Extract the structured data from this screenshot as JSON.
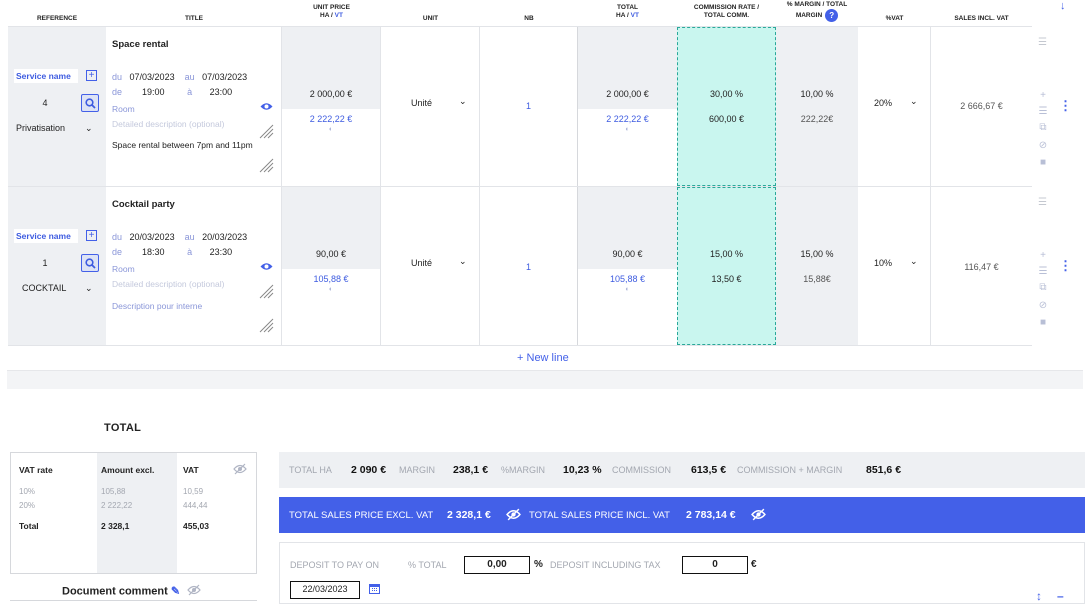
{
  "headers": {
    "reference": "REFERENCE",
    "title": "TITLE",
    "unit_price_1": "UNIT PRICE",
    "unit_price_2": "HA /",
    "unit_price_vt": "VT",
    "unit": "UNIT",
    "nb": "NB",
    "total_1": "TOTAL",
    "total_2": "HA /",
    "total_vt": "VT",
    "commission_1": "COMMISSION RATE /",
    "commission_2": "TOTAL COMM.",
    "margin_1": "% MARGIN / TOTAL",
    "margin_2": "MARGIN",
    "help": "?",
    "vat": "%VAT",
    "sales": "SALES INCL. VAT"
  },
  "rows": [
    {
      "service_label": "Service name",
      "quantity": "4",
      "category": "Privatisation",
      "title": "Space rental",
      "du_label": "du",
      "date_from": "07/03/2023",
      "au_label": "au",
      "date_to": "07/03/2023",
      "de_label": "de",
      "time_from": "19:00",
      "a_label": "à",
      "time_to": "23:00",
      "room_placeholder": "Room",
      "desc_placeholder": "Detailed description (optional)",
      "extra_text": "Space rental between 7pm and 11pm",
      "unit_price_ha": "2 000,00 €",
      "unit_price_vt": "2 222,22 €",
      "unit": "Unité",
      "nb": "1",
      "total_ha": "2 000,00 €",
      "total_vt": "2 222,22 €",
      "commission_rate": "30,00 %",
      "total_comm": "600,00 €",
      "margin_pct": "10,00 %",
      "total_margin": "222,22€",
      "vat": "20%",
      "sales_incl_vat": "2 666,67 €"
    },
    {
      "service_label": "Service name",
      "quantity": "1",
      "category": "COCKTAIL",
      "title": "Cocktail party",
      "du_label": "du",
      "date_from": "20/03/2023",
      "au_label": "au",
      "date_to": "20/03/2023",
      "de_label": "de",
      "time_from": "18:30",
      "a_label": "à",
      "time_to": "23:30",
      "room_placeholder": "Room",
      "desc_placeholder": "Detailed description (optional)",
      "extra_text": "Description pour interne",
      "unit_price_ha": "90,00 €",
      "unit_price_vt": "105,88 €",
      "unit": "Unité",
      "nb": "1",
      "total_ha": "90,00 €",
      "total_vt": "105,88 €",
      "commission_rate": "15,00 %",
      "total_comm": "13,50 €",
      "margin_pct": "15,00 %",
      "total_margin": "15,88€",
      "vat": "10%",
      "sales_incl_vat": "116,47 €"
    }
  ],
  "new_line": "New line",
  "total_title": "TOTAL",
  "vat_table": {
    "h_rate": "VAT rate",
    "h_amount": "Amount excl.",
    "h_vat": "VAT",
    "rows": [
      {
        "rate": "10%",
        "amount": "105,88",
        "vat": "10,59"
      },
      {
        "rate": "20%",
        "amount": "2 222,22",
        "vat": "444,44"
      }
    ],
    "total_label": "Total",
    "total_amount": "2 328,1",
    "total_vat": "455,03"
  },
  "document_comment": "Document comment",
  "stats": {
    "total_ha_label": "TOTAL HA",
    "total_ha": "2 090 €",
    "margin_label": "MARGIN",
    "margin": "238,1 €",
    "pct_margin_label": "%MARGIN",
    "pct_margin": "10,23 %",
    "commission_label": "COMMISSION",
    "commission": "613,5 €",
    "comm_margin_label": "COMMISSION + MARGIN",
    "comm_margin": "851,6 €"
  },
  "sales": {
    "excl_label": "TOTAL SALES PRICE EXCL. VAT",
    "excl": "2 328,1 €",
    "incl_label": "TOTAL SALES PRICE INCL. VAT",
    "incl": "2 783,14 €"
  },
  "deposit": {
    "pay_on_label": "DEPOSIT TO PAY ON",
    "pct_total_label": "% TOTAL",
    "pct_value": "0,00",
    "pct_symbol": "%",
    "incl_tax_label": "DEPOSIT INCLUDING TAX",
    "incl_tax_value": "0",
    "currency": "€",
    "date": "22/03/2023"
  },
  "colors": {
    "accent": "#4360e8",
    "commission_bg": "#c9f6ef"
  }
}
